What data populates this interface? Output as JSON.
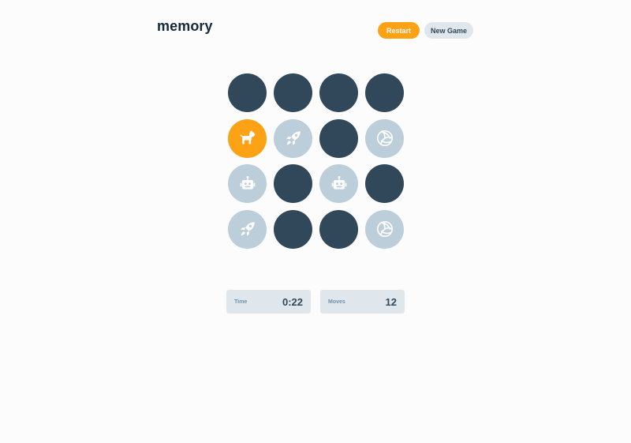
{
  "header": {
    "logo": "memory",
    "restart_label": "Restart",
    "new_game_label": "New Game"
  },
  "colors": {
    "accent": "#fda214",
    "hidden_tile": "#304859",
    "matched_tile": "#bcced9",
    "text_dark": "#152938",
    "panel_bg": "#dfe7ec"
  },
  "board": {
    "rows": 4,
    "columns": 4,
    "tiles": [
      {
        "state": "hidden",
        "icon": null
      },
      {
        "state": "hidden",
        "icon": null
      },
      {
        "state": "hidden",
        "icon": null
      },
      {
        "state": "hidden",
        "icon": null
      },
      {
        "state": "active",
        "icon": "dog-icon"
      },
      {
        "state": "matched",
        "icon": "rocket-icon"
      },
      {
        "state": "hidden",
        "icon": null
      },
      {
        "state": "matched",
        "icon": "volleyball-icon"
      },
      {
        "state": "matched",
        "icon": "robot-icon"
      },
      {
        "state": "hidden",
        "icon": null
      },
      {
        "state": "matched",
        "icon": "robot-icon"
      },
      {
        "state": "hidden",
        "icon": null
      },
      {
        "state": "matched",
        "icon": "rocket-icon"
      },
      {
        "state": "hidden",
        "icon": null
      },
      {
        "state": "hidden",
        "icon": null
      },
      {
        "state": "matched",
        "icon": "volleyball-icon"
      }
    ]
  },
  "stats": {
    "time_label": "Time",
    "time_value": "0:22",
    "moves_label": "Moves",
    "moves_value": "12"
  }
}
